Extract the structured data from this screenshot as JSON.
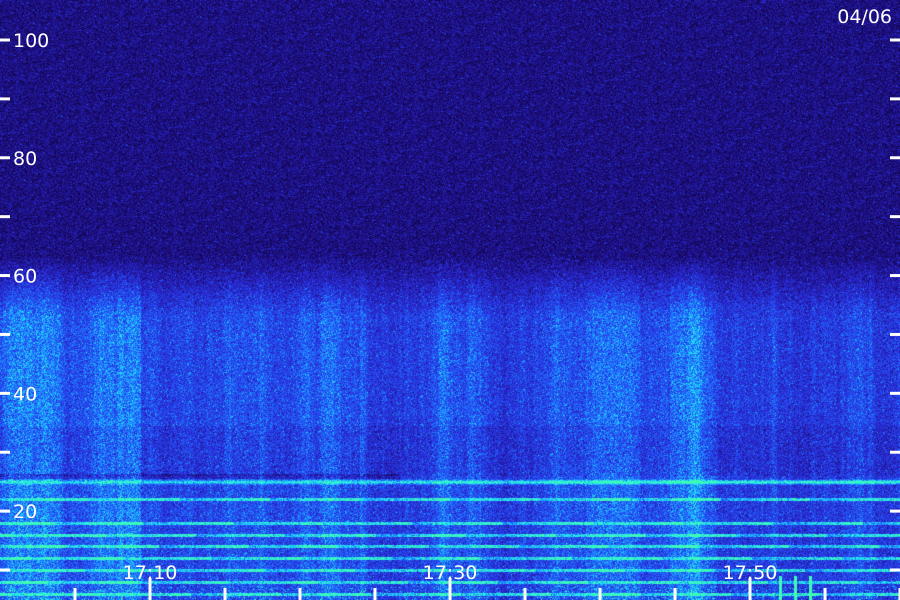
{
  "chart_data": {
    "type": "heatmap",
    "title": "",
    "xlabel": "",
    "ylabel": "",
    "date": "04/06",
    "y_ticks": [
      {
        "value": 100,
        "label": "100"
      },
      {
        "value": 80,
        "label": "80"
      },
      {
        "value": 60,
        "label": "60"
      },
      {
        "value": 40,
        "label": "40"
      },
      {
        "value": 20,
        "label": "20"
      }
    ],
    "y_minor_ticks": [
      90,
      70,
      50,
      30,
      10,
      0
    ],
    "ylim": [
      0,
      104
    ],
    "x_ticks": [
      {
        "value": "17:10",
        "label": "17:10"
      },
      {
        "value": "17:30",
        "label": "17:30"
      },
      {
        "value": "17:50",
        "label": "17:50"
      }
    ],
    "x_range_minutes": [
      "17:05",
      "18:05"
    ],
    "x_minor_tick_step_minutes": 5,
    "colormap": [
      "#000010",
      "#1a0a6e",
      "#2a2ad8",
      "#1f6cff",
      "#1fe0ff",
      "#40ffb0"
    ],
    "features": {
      "dense_band_ylim": [
        0,
        60
      ],
      "persistent_line_y": 25,
      "low_emission_lines_y": [
        22,
        18,
        16,
        14,
        12,
        10,
        8,
        6,
        3
      ],
      "bright_bursts_time": [
        "17:52",
        "17:53",
        "17:54"
      ]
    }
  }
}
